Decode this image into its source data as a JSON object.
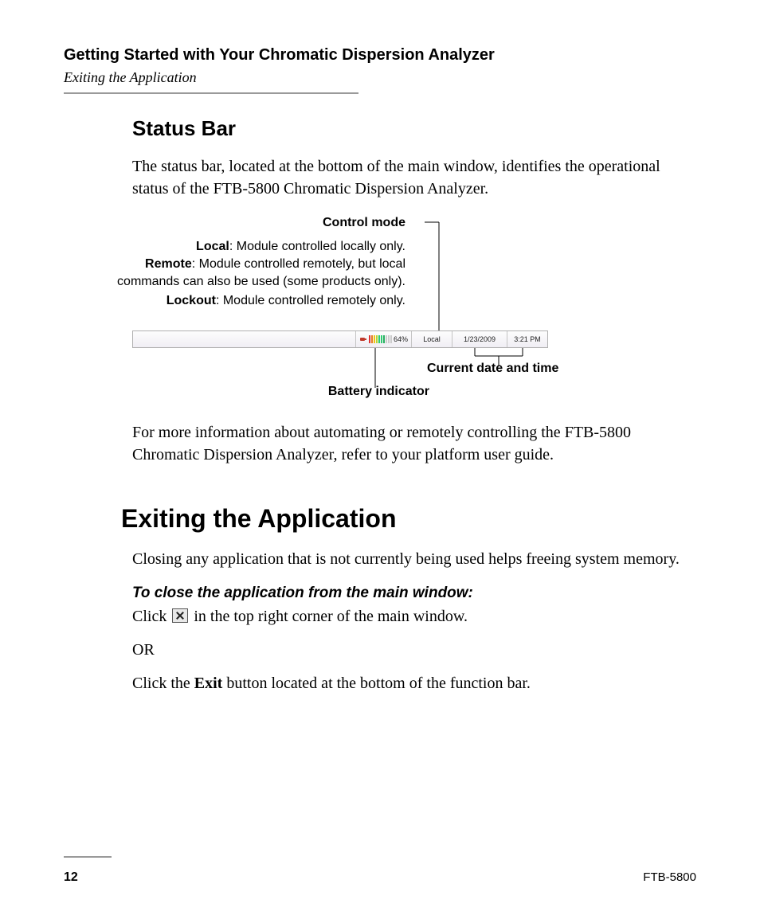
{
  "header": {
    "chapter": "Getting Started with Your Chromatic Dispersion Analyzer",
    "section": "Exiting the Application"
  },
  "status_bar_section": {
    "heading": "Status Bar",
    "intro": "The status bar, located at the bottom of the main window, identifies the operational status of the FTB-5800 Chromatic Dispersion Analyzer."
  },
  "figure": {
    "control_mode_label": "Control mode",
    "local_term": "Local",
    "local_desc": ": Module controlled locally only.",
    "remote_term": "Remote",
    "remote_desc": ": Module controlled remotely, but local commands can also be used (some products only).",
    "lockout_term": "Lockout",
    "lockout_desc": ": Module controlled remotely only.",
    "datetime_label": "Current date and time",
    "battery_label": "Battery indicator",
    "statusbar": {
      "battery_pct": "64%",
      "mode": "Local",
      "date": "1/23/2009",
      "time": "3:21 PM"
    }
  },
  "after_figure": "For more information about automating or remotely controlling the FTB-5800 Chromatic Dispersion Analyzer, refer to your platform user guide.",
  "exiting": {
    "heading": "Exiting the Application",
    "intro": "Closing any application that is not currently being used helps freeing system memory.",
    "proc_heading": "To close the application from the main window:",
    "step1_pre": "Click ",
    "step1_post": " in the top right corner of the main window.",
    "or": "OR",
    "step2_pre": "Click the ",
    "step2_bold": "Exit",
    "step2_post": " button located at the bottom of the function bar."
  },
  "footer": {
    "page": "12",
    "model": "FTB-5800"
  }
}
